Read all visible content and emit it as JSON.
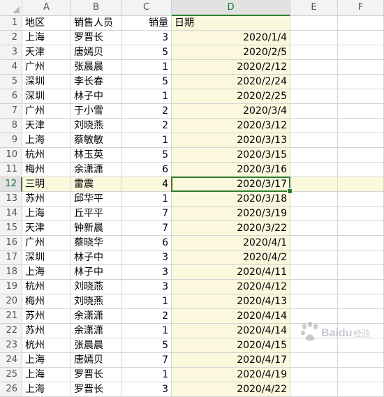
{
  "columns": [
    "A",
    "B",
    "C",
    "D",
    "E",
    "F"
  ],
  "selected_column": "D",
  "selected_row": 12,
  "rows": [
    {
      "row": "1",
      "a": "地区",
      "b": "销售人员",
      "c": "销量",
      "d": "日期"
    },
    {
      "row": "2",
      "a": "上海",
      "b": "罗晋长",
      "c": "3",
      "d": "2020/1/4"
    },
    {
      "row": "3",
      "a": "天津",
      "b": "唐嫣贝",
      "c": "5",
      "d": "2020/2/5"
    },
    {
      "row": "4",
      "a": "广州",
      "b": "张晨晨",
      "c": "1",
      "d": "2020/2/12"
    },
    {
      "row": "5",
      "a": "深圳",
      "b": "李长春",
      "c": "5",
      "d": "2020/2/24"
    },
    {
      "row": "6",
      "a": "深圳",
      "b": "林子中",
      "c": "1",
      "d": "2020/2/25"
    },
    {
      "row": "7",
      "a": "广州",
      "b": "于小雪",
      "c": "2",
      "d": "2020/3/4"
    },
    {
      "row": "8",
      "a": "天津",
      "b": "刘晓燕",
      "c": "2",
      "d": "2020/3/12"
    },
    {
      "row": "9",
      "a": "上海",
      "b": "蔡敏敏",
      "c": "1",
      "d": "2020/3/13"
    },
    {
      "row": "10",
      "a": "杭州",
      "b": "林玉英",
      "c": "5",
      "d": "2020/3/15"
    },
    {
      "row": "11",
      "a": "梅州",
      "b": "余潇潇",
      "c": "6",
      "d": "2020/3/16"
    },
    {
      "row": "12",
      "a": "三明",
      "b": "雷震",
      "c": "4",
      "d": "2020/3/17"
    },
    {
      "row": "13",
      "a": "苏州",
      "b": "邱华平",
      "c": "1",
      "d": "2020/3/18"
    },
    {
      "row": "14",
      "a": "上海",
      "b": "丘平平",
      "c": "7",
      "d": "2020/3/19"
    },
    {
      "row": "15",
      "a": "天津",
      "b": "钟新晨",
      "c": "7",
      "d": "2020/3/22"
    },
    {
      "row": "16",
      "a": "广州",
      "b": "蔡晓华",
      "c": "6",
      "d": "2020/4/1"
    },
    {
      "row": "17",
      "a": "深圳",
      "b": "林子中",
      "c": "3",
      "d": "2020/4/2"
    },
    {
      "row": "18",
      "a": "上海",
      "b": "林子中",
      "c": "3",
      "d": "2020/4/11"
    },
    {
      "row": "19",
      "a": "杭州",
      "b": "刘晓燕",
      "c": "3",
      "d": "2020/4/12"
    },
    {
      "row": "20",
      "a": "梅州",
      "b": "刘晓燕",
      "c": "1",
      "d": "2020/4/13"
    },
    {
      "row": "21",
      "a": "苏州",
      "b": "余潇潇",
      "c": "2",
      "d": "2020/4/14"
    },
    {
      "row": "22",
      "a": "苏州",
      "b": "余潇潇",
      "c": "1",
      "d": "2020/4/14"
    },
    {
      "row": "23",
      "a": "杭州",
      "b": "张晨晨",
      "c": "5",
      "d": "2020/4/15"
    },
    {
      "row": "24",
      "a": "上海",
      "b": "唐嫣贝",
      "c": "7",
      "d": "2020/4/17"
    },
    {
      "row": "25",
      "a": "上海",
      "b": "罗晋长",
      "c": "1",
      "d": "2020/4/19"
    },
    {
      "row": "26",
      "a": "上海",
      "b": "罗晋长",
      "c": "3",
      "d": "2020/4/22"
    }
  ],
  "colors": {
    "header_bg": "#f3f3f3",
    "selection_green": "#2e7d32",
    "highlight_yellow": "#fbf8dd",
    "gridline": "#d4d4d4"
  },
  "watermark": {
    "text": "Baidu 经验",
    "icon": "baidu-paw-icon"
  }
}
